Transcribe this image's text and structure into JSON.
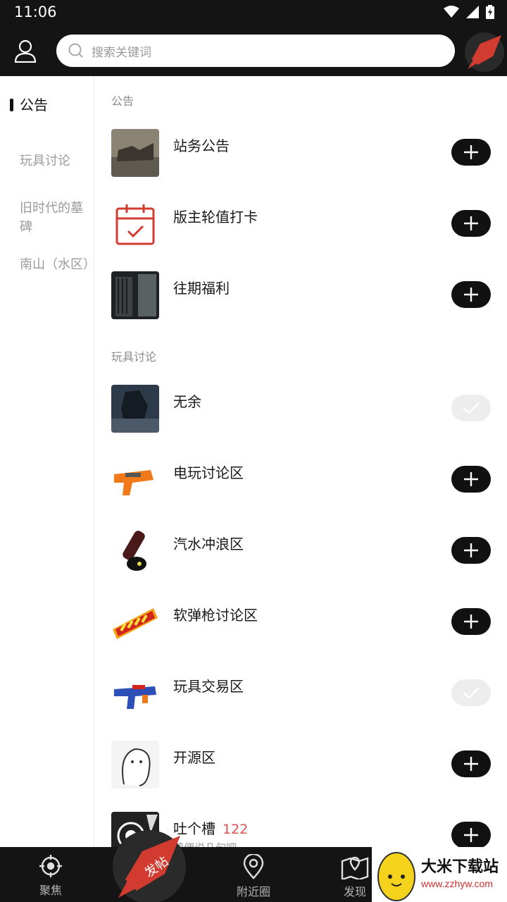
{
  "status_bar": {
    "time": "11:06"
  },
  "header": {
    "search_placeholder": "搜索关键词",
    "post_badge": "发帖"
  },
  "sidebar": {
    "items": [
      {
        "label": "公告",
        "active": true
      },
      {
        "label": "玩具讨论",
        "active": false
      },
      {
        "label": "旧时代的墓碑",
        "active": false
      },
      {
        "label": "南山（水区）",
        "active": false
      }
    ]
  },
  "sections": [
    {
      "title": "公告",
      "rows": [
        {
          "name": "站务公告",
          "state": "add",
          "thumb": "soldiers-photo"
        },
        {
          "name": "版主轮值打卡",
          "state": "add",
          "thumb": "calendar-check-icon"
        },
        {
          "name": "往期福利",
          "state": "add",
          "thumb": "dark-room-photo"
        }
      ]
    },
    {
      "title": "玩具讨论",
      "rows": [
        {
          "name": "无余",
          "state": "joined",
          "thumb": "game-character-photo"
        },
        {
          "name": "电玩讨论区",
          "state": "add",
          "thumb": "orange-blaster-photo"
        },
        {
          "name": "汽水冲浪区",
          "state": "add",
          "thumb": "soda-cat-photo"
        },
        {
          "name": "软弹枪讨论区",
          "state": "add",
          "thumb": "nerf-logo"
        },
        {
          "name": "玩具交易区",
          "state": "joined",
          "thumb": "blue-blaster-photo"
        },
        {
          "name": "开源区",
          "state": "add",
          "thumb": "sketch-creature-photo"
        },
        {
          "name": "吐个槽",
          "count": "122",
          "sub": "随便说几句吧",
          "state": "add",
          "thumb": "target-photo"
        }
      ]
    }
  ],
  "bottom_nav": {
    "items": [
      {
        "label": "聚焦",
        "icon": "crosshair-icon"
      },
      {
        "label": "附近圈",
        "icon": "location-pin-icon"
      },
      {
        "label": "发现",
        "icon": "map-icon"
      }
    ],
    "center_badge": "发帖"
  },
  "watermark": {
    "title": "大米下载站",
    "url": "www.zzhyw.com"
  },
  "colors": {
    "bar_bg": "#141414",
    "accent_red": "#d9534f",
    "rocket_red": "#d23b30"
  }
}
